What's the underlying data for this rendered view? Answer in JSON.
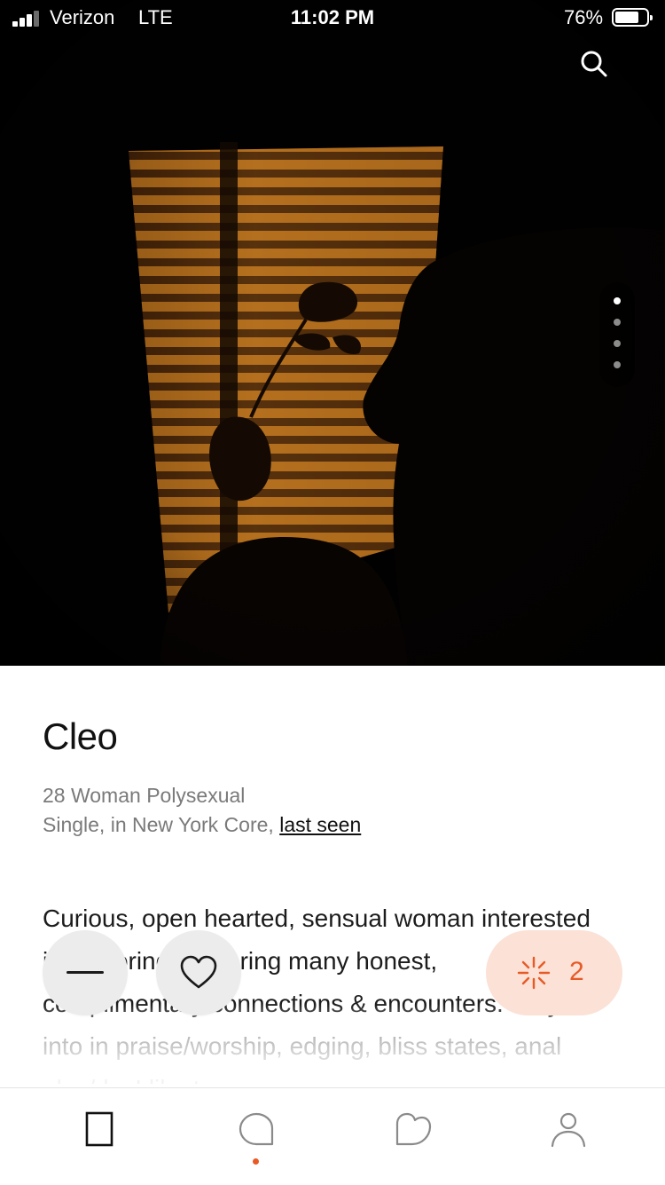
{
  "status_bar": {
    "carrier": "Verizon",
    "network": "LTE",
    "time": "11:02 PM",
    "battery_percent": "76%",
    "battery_level": 0.76,
    "signal_bars": 3
  },
  "photo": {
    "page_count": 4,
    "active_page": 1
  },
  "profile": {
    "name": "Cleo",
    "details_line1": "28 Woman Polysexual",
    "details_line2": "Single, in New York Core,",
    "last_seen_link": "last seen",
    "bio": "Curious, open hearted, sensual woman interested in exploring & sharing many honest, complimentary connections & encounters. Very into in praise/worship, edging, bliss states, anal play/ds. I like to"
  },
  "actions": {
    "spark_count": "2"
  },
  "icons": {
    "search": "search-icon",
    "dismiss": "minus-icon",
    "like": "heart-icon",
    "spark": "spark-icon"
  },
  "tabbar": {
    "tabs": [
      "discover-tab",
      "chats-tab",
      "likes-tab",
      "profile-tab"
    ],
    "notification_tab": "chats-tab"
  },
  "colors": {
    "accent": "#e75a26",
    "pill_bg": "#fbe1d6",
    "button_bg": "#ececec"
  }
}
